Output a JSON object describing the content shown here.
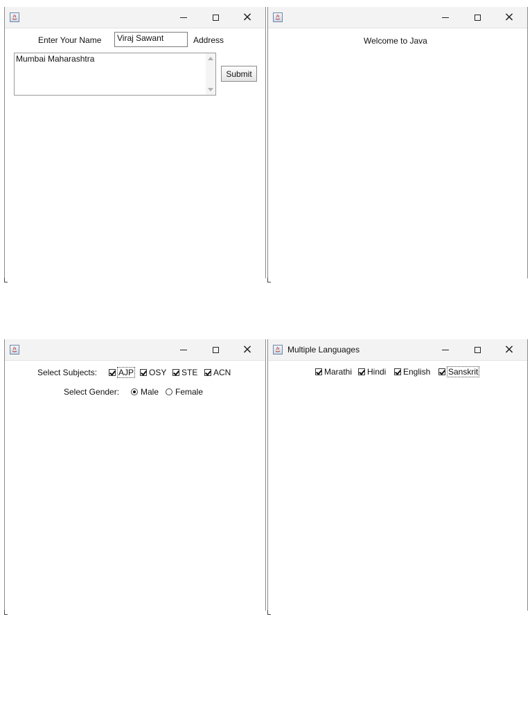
{
  "window_controls": {
    "close_glyph": "×"
  },
  "window1": {
    "title": "",
    "name_label": "Enter Your Name",
    "name_value": "Viraj Sawant",
    "address_label": "Address",
    "address_value": "Mumbai Maharashtra",
    "submit_label": "Submit"
  },
  "window2": {
    "title": "",
    "welcome_text": "Welcome to Java"
  },
  "window3": {
    "title": "",
    "subjects_label": "Select Subjects:",
    "subjects": [
      {
        "label": "AJP",
        "checked": true,
        "focused": true
      },
      {
        "label": "OSY",
        "checked": true
      },
      {
        "label": "STE",
        "checked": true
      },
      {
        "label": "ACN",
        "checked": true
      }
    ],
    "gender_label": "Select Gender:",
    "genders": [
      {
        "label": "Male",
        "selected": true
      },
      {
        "label": "Female",
        "selected": false
      }
    ]
  },
  "window4": {
    "title": "Multiple Languages",
    "languages": [
      {
        "label": "Marathi",
        "checked": true
      },
      {
        "label": "Hindi",
        "checked": true
      },
      {
        "label": "English",
        "checked": true
      },
      {
        "label": "Sanskrit",
        "checked": true,
        "focused": true
      }
    ]
  }
}
